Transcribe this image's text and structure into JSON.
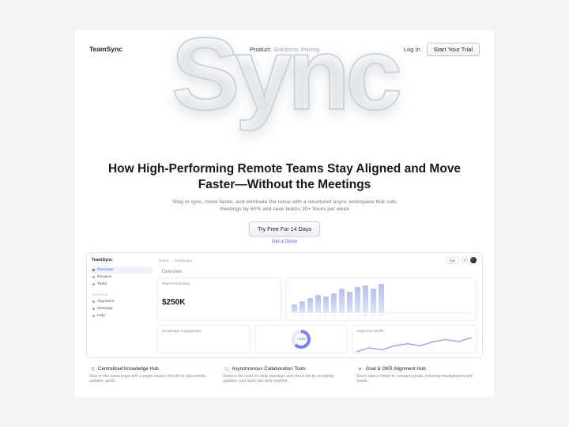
{
  "brand": "TeamSync",
  "nav": {
    "product": "Product",
    "solutions": "Solutions",
    "pricing": "Pricing"
  },
  "auth": {
    "login": "Log In",
    "start_trial": "Start Your Trial"
  },
  "bg_word": "Sync",
  "hero": {
    "headline": "How High-Performing Remote Teams Stay Aligned and Move Faster—Without the Meetings",
    "subhead": "Stay in sync, move faster, and eliminate the noise with a structured async workspace that cuts meetings by 60% and save teams 20+ hours per week",
    "cta_primary": "Try Free For 14 Days",
    "cta_secondary": "Get a Demo"
  },
  "dashboard": {
    "brand": "TeamSync",
    "primary_items": [
      {
        "label": "Overview",
        "active": true
      },
      {
        "label": "Reviews",
        "active": false
      },
      {
        "label": "Tasks",
        "active": false
      }
    ],
    "group_label": "Manage",
    "manage_items": [
      {
        "label": "Alignment"
      },
      {
        "label": "Meetings"
      },
      {
        "label": "Help"
      }
    ],
    "breadcrumb": [
      "Home",
      "Dashboard"
    ],
    "filter_chip": "Day",
    "overview_title": "Overview",
    "productivity": {
      "title": "Team Productivity",
      "metric": "$250K"
    },
    "engagement": {
      "title": "Knowledge Engagement",
      "donut_pct": 63,
      "donut_label": "+ 63%"
    },
    "alignment": {
      "title": "Alignment Health"
    },
    "chart_data": {
      "type": "bar",
      "title": "Team Productivity",
      "categories": [
        "1",
        "2",
        "3",
        "4",
        "5",
        "6",
        "7",
        "8",
        "9",
        "10",
        "11",
        "12"
      ],
      "values": [
        10,
        14,
        18,
        22,
        20,
        24,
        30,
        26,
        32,
        34,
        30,
        36
      ],
      "ylim": [
        0,
        40
      ]
    },
    "alignment_series": {
      "type": "line",
      "x": [
        0,
        1,
        2,
        3,
        4,
        5,
        6,
        7,
        8,
        9
      ],
      "y": [
        3,
        5,
        4,
        6,
        7,
        6,
        8,
        9,
        8,
        10
      ]
    }
  },
  "features": [
    {
      "icon": "notebook-icon",
      "color": "ic-blue",
      "title": "Centralized Knowledge Hub",
      "body": "Stay on the same page with a single source of truth for documents, updates, goals."
    },
    {
      "icon": "refresh-icon",
      "color": "ic-indigo",
      "title": "Asynchronous Collaboration Tools",
      "body": "Reduce the need for daily standups and check-ins by recording updates your team can view anytime."
    },
    {
      "icon": "target-icon",
      "color": "ic-violet",
      "title": "Goal & OKR Alignment Hub",
      "body": "Every task is linked to company goals, reducing misalignment and waste."
    }
  ]
}
